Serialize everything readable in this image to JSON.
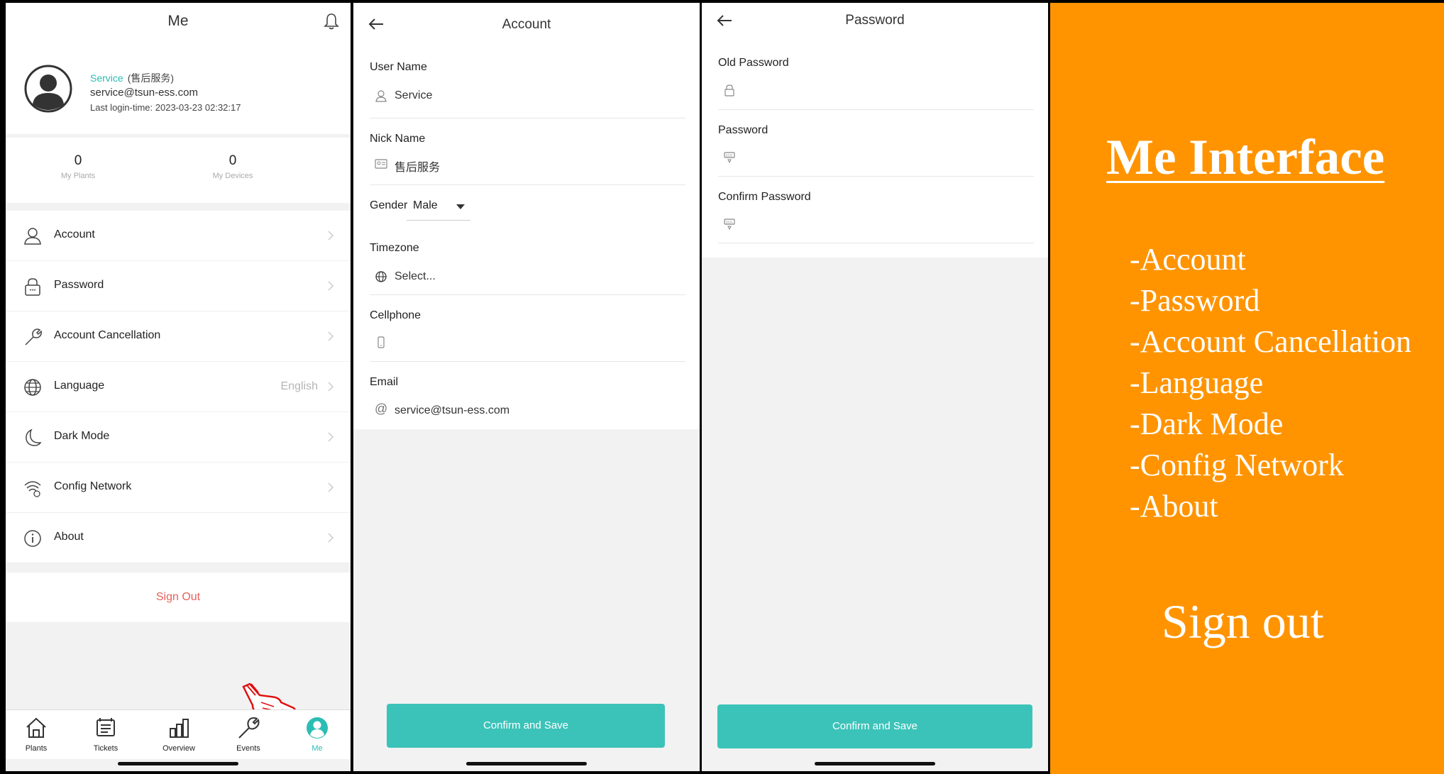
{
  "me_screen": {
    "title": "Me",
    "profile": {
      "name": "Service",
      "nickname": "(售后服务)",
      "email": "service@tsun-ess.com",
      "last_login": "Last login-time:  2023-03-23 02:32:17"
    },
    "stats": [
      {
        "value": "0",
        "label": "My Plants"
      },
      {
        "value": "0",
        "label": "My Devices"
      }
    ],
    "menu": [
      {
        "label": "Account",
        "icon": "user-icon",
        "value": ""
      },
      {
        "label": "Password",
        "icon": "lock-icon",
        "value": ""
      },
      {
        "label": "Account Cancellation",
        "icon": "wrench-icon",
        "value": ""
      },
      {
        "label": "Language",
        "icon": "globe-icon",
        "value": "English"
      },
      {
        "label": "Dark Mode",
        "icon": "moon-icon",
        "value": ""
      },
      {
        "label": "Config Network",
        "icon": "wifi-config-icon",
        "value": ""
      },
      {
        "label": "About",
        "icon": "info-icon",
        "value": ""
      }
    ],
    "sign_out": "Sign Out",
    "tabs": [
      {
        "label": "Plants",
        "icon": "home-icon"
      },
      {
        "label": "Tickets",
        "icon": "ticket-icon"
      },
      {
        "label": "Overview",
        "icon": "bar-chart-icon"
      },
      {
        "label": "Events",
        "icon": "wrench-icon"
      },
      {
        "label": "Me",
        "icon": "person-icon",
        "active": true
      }
    ]
  },
  "account_screen": {
    "title": "Account",
    "fields": {
      "user_name": {
        "label": "User Name",
        "value": "Service"
      },
      "nick_name": {
        "label": "Nick Name",
        "value": "售后服务"
      },
      "gender": {
        "label": "Gender",
        "value": "Male"
      },
      "timezone": {
        "label": "Timezone",
        "value": "Select..."
      },
      "cellphone": {
        "label": "Cellphone",
        "value": ""
      },
      "email": {
        "label": "Email",
        "value": "service@tsun-ess.com"
      }
    },
    "confirm_button": "Confirm and Save"
  },
  "password_screen": {
    "title": "Password",
    "fields": {
      "old_password": {
        "label": "Old Password"
      },
      "password": {
        "label": "Password"
      },
      "confirm_password": {
        "label": "Confirm Password"
      }
    },
    "confirm_button": "Confirm and Save"
  },
  "info_panel": {
    "title": "Me Interface",
    "items": [
      "-Account",
      "-Password",
      "-Account Cancellation",
      "-Language",
      "-Dark Mode",
      "-Config Network",
      "-About"
    ],
    "sign_out": "Sign out"
  },
  "colors": {
    "accent": "#3cc3b9",
    "signout": "#e8615c",
    "panel": "#ff9400"
  }
}
